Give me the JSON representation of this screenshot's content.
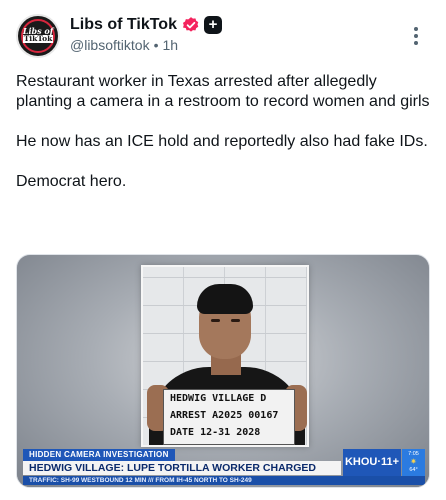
{
  "post": {
    "author": {
      "display_name": "Libs of TikTok",
      "handle": "@libsoftiktok",
      "separator": "•",
      "time": "1h",
      "avatar_logo_line1": "Libs of",
      "avatar_logo_line2": "TikTok",
      "verified_icon": "verified-badge-icon",
      "verified_color": "#f4245e",
      "plus_label": "+"
    },
    "more_icon": "more-options-icon",
    "text_paragraphs": [
      "Restaurant worker in Texas arrested after allegedly planting a camera in a restroom to record women and girls",
      "He now has an ICE hold and reportedly also had fake IDs.",
      "Democrat hero."
    ],
    "media": {
      "board_line1": "HEDWIG VILLAGE   D",
      "board_line2": "ARREST A2025 00167",
      "board_line3": "DATE 12-31      2028",
      "chyron_tag": "HIDDEN CAMERA INVESTIGATION",
      "chyron_headline": "HEDWIG VILLAGE: LUPE TORTILLA WORKER CHARGED",
      "chyron_ticker": "TRAFFIC: SH-99 WESTBOUND 12 MIN   ///  FROM IH-45 NORTH TO SH-249",
      "channel_brand": "KHOU·11+",
      "weather_time": "7:05",
      "weather_temp": "64°",
      "weather_icon": "sun-icon",
      "accent_color": "#1f57b8"
    }
  }
}
